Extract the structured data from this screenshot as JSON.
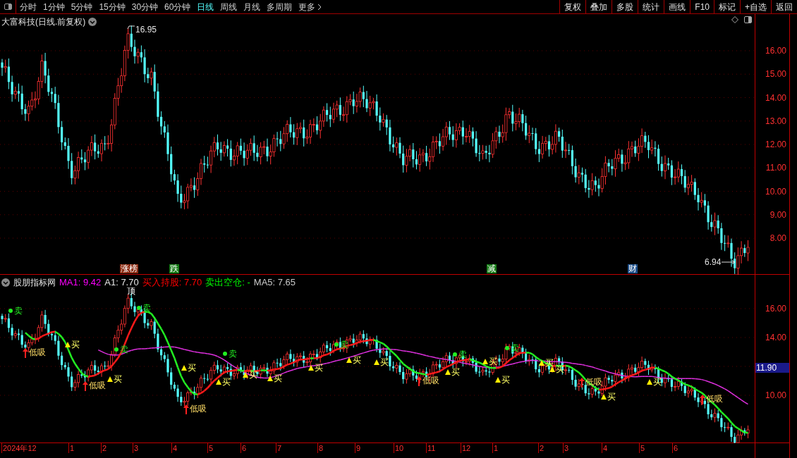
{
  "toolbar": {
    "periods": [
      {
        "label": "分时",
        "selected": false
      },
      {
        "label": "1分钟",
        "selected": false
      },
      {
        "label": "5分钟",
        "selected": false
      },
      {
        "label": "15分钟",
        "selected": false
      },
      {
        "label": "30分钟",
        "selected": false
      },
      {
        "label": "60分钟",
        "selected": false
      },
      {
        "label": "日线",
        "selected": true
      },
      {
        "label": "周线",
        "selected": false
      },
      {
        "label": "月线",
        "selected": false
      },
      {
        "label": "多周期",
        "selected": false
      },
      {
        "label": "更多",
        "selected": false
      }
    ],
    "buttons": [
      "复权",
      "叠加",
      "多股",
      "统计",
      "画线",
      "F10",
      "标记",
      "+自选",
      "返回"
    ]
  },
  "main_chart": {
    "title": "大富科技(日线.前复权)",
    "high_label": "16.95",
    "low_label": "6.94",
    "axis_labels": [
      "16.00",
      "15.00",
      "14.00",
      "13.00",
      "12.00",
      "11.00",
      "10.00",
      "9.00",
      "8.00"
    ],
    "events": [
      {
        "text": "涨榜",
        "color": "#8b2a10"
      },
      {
        "text": "跌",
        "color": "#157a15"
      },
      {
        "text": "减",
        "color": "#157a15"
      },
      {
        "text": "财",
        "color": "#1d4f8a"
      }
    ]
  },
  "indicator": {
    "name": "股朋指标网",
    "legend": [
      {
        "text": "MA1: 9.42",
        "color": "#ff00ff"
      },
      {
        "text": "A1: 7.70",
        "color": "#e6e6e6"
      },
      {
        "text": "买入持股: 7.70",
        "color": "#ff0000"
      },
      {
        "text": "卖出空仓: -",
        "color": "#00ff00"
      },
      {
        "text": "MA5: 7.65",
        "color": "#c8c8c8"
      }
    ],
    "axis_labels": [
      "16.00",
      "14.00",
      "10.00"
    ],
    "current_price": "11.90",
    "signals": [
      {
        "kind": "sell",
        "text": "卖"
      },
      {
        "kind": "low",
        "text": "低吸"
      },
      {
        "kind": "buy",
        "text": "买"
      },
      {
        "kind": "low",
        "text": "低吸"
      },
      {
        "kind": "buy",
        "text": "买"
      },
      {
        "kind": "sell",
        "text": "卖"
      },
      {
        "kind": "top",
        "text": "顶"
      },
      {
        "kind": "sell",
        "text": "卖"
      },
      {
        "kind": "buy",
        "text": "买"
      },
      {
        "kind": "low",
        "text": "低吸"
      },
      {
        "kind": "buy",
        "text": "买"
      },
      {
        "kind": "sell",
        "text": "卖"
      },
      {
        "kind": "buy",
        "text": "买"
      },
      {
        "kind": "buy",
        "text": "买"
      },
      {
        "kind": "buy",
        "text": "买"
      },
      {
        "kind": "sell",
        "text": "卖"
      },
      {
        "kind": "buy",
        "text": "买"
      },
      {
        "kind": "buy",
        "text": "买"
      },
      {
        "kind": "low",
        "text": "低吸"
      },
      {
        "kind": "buy",
        "text": "买"
      },
      {
        "kind": "sell",
        "text": "卖"
      },
      {
        "kind": "buy",
        "text": "买"
      },
      {
        "kind": "buy",
        "text": "买"
      },
      {
        "kind": "sell",
        "text": "卖"
      },
      {
        "kind": "buy",
        "text": "买"
      },
      {
        "kind": "buy",
        "text": "买"
      },
      {
        "kind": "low",
        "text": "低吸"
      },
      {
        "kind": "buy",
        "text": "买"
      },
      {
        "kind": "buy",
        "text": "买"
      },
      {
        "kind": "low",
        "text": "低吸"
      }
    ]
  },
  "date_axis": [
    "2024年12",
    "1",
    "2",
    "3",
    "4",
    "5",
    "6",
    "7",
    "8",
    "9",
    "10",
    "11",
    "12",
    "1",
    "2",
    "3",
    "4",
    "5",
    "6"
  ]
}
